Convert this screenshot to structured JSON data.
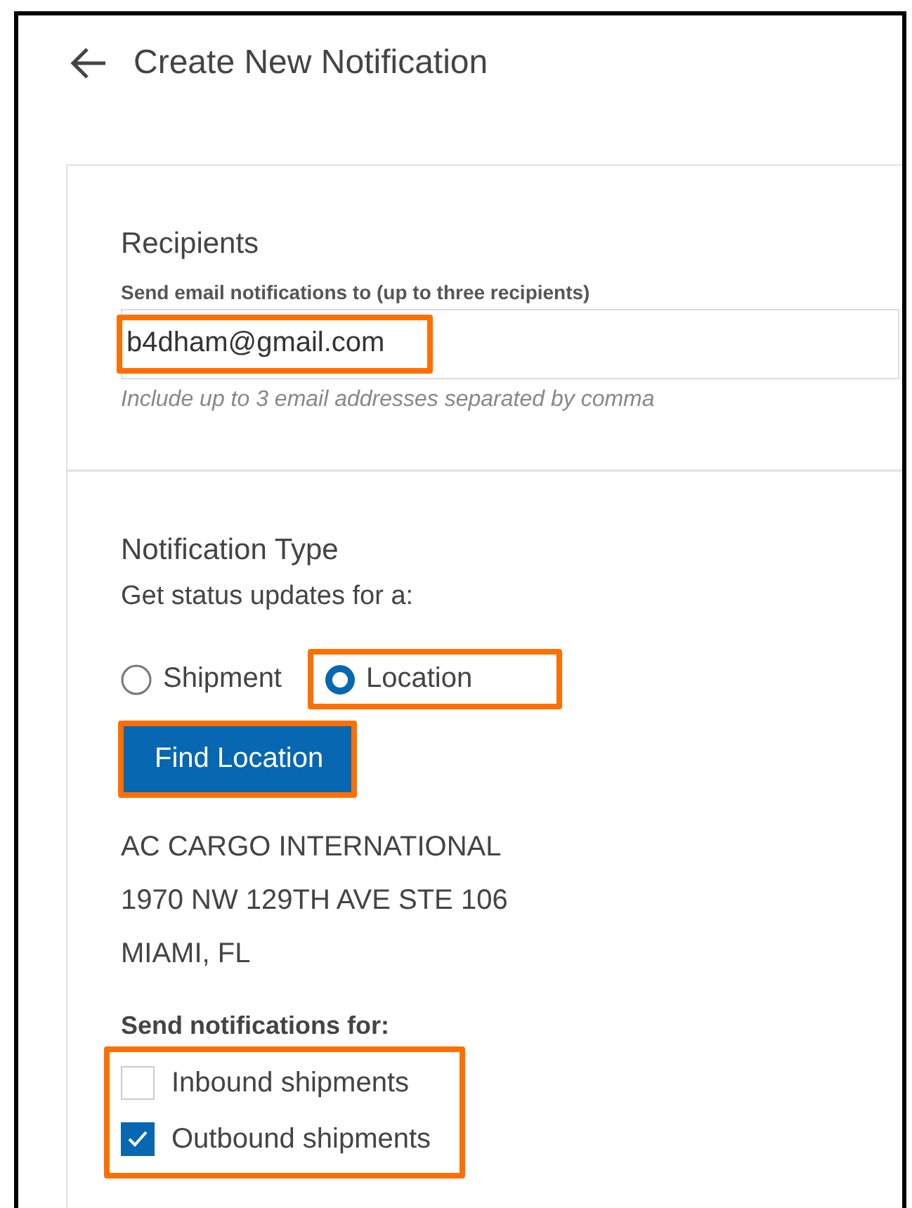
{
  "header": {
    "title": "Create New Notification"
  },
  "recipients": {
    "title": "Recipients",
    "label": "Send email notifications to (up to three recipients)",
    "value": "b4dham@gmail.com",
    "highlighted": true,
    "hint": "Include up to 3 email addresses separated by comma"
  },
  "notification_type": {
    "title": "Notification Type",
    "prompt": "Get status updates for a:",
    "options": [
      {
        "label": "Shipment",
        "selected": false,
        "highlighted": false
      },
      {
        "label": "Location",
        "selected": true,
        "highlighted": true
      }
    ],
    "button": {
      "label": "Find Location",
      "highlighted": true
    },
    "address": [
      "AC CARGO INTERNATIONAL",
      "1970 NW 129TH AVE STE 106",
      "MIAMI, FL"
    ],
    "send_for": {
      "title": "Send notifications for:",
      "highlighted": true,
      "options": [
        {
          "label": "Inbound shipments",
          "checked": false
        },
        {
          "label": "Outbound shipments",
          "checked": true
        }
      ]
    }
  }
}
